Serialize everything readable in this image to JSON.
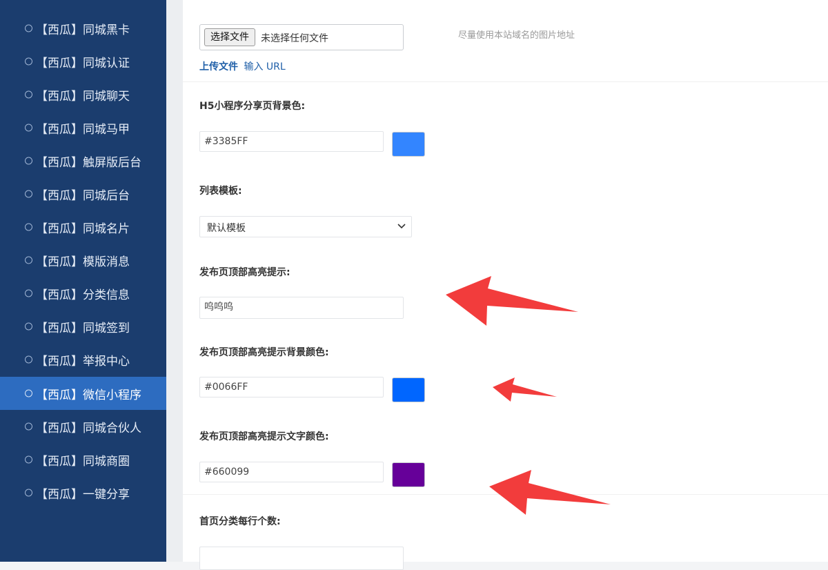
{
  "sidebar": {
    "items": [
      {
        "label": "【西瓜】同城黑卡",
        "active": false
      },
      {
        "label": "【西瓜】同城认证",
        "active": false
      },
      {
        "label": "【西瓜】同城聊天",
        "active": false
      },
      {
        "label": "【西瓜】同城马甲",
        "active": false
      },
      {
        "label": "【西瓜】触屏版后台",
        "active": false
      },
      {
        "label": "【西瓜】同城后台",
        "active": false
      },
      {
        "label": "【西瓜】同城名片",
        "active": false
      },
      {
        "label": "【西瓜】模版消息",
        "active": false
      },
      {
        "label": "【西瓜】分类信息",
        "active": false
      },
      {
        "label": "【西瓜】同城签到",
        "active": false
      },
      {
        "label": "【西瓜】举报中心",
        "active": false
      },
      {
        "label": "【西瓜】微信小程序",
        "active": true
      },
      {
        "label": "【西瓜】同城合伙人",
        "active": false
      },
      {
        "label": "【西瓜】同城商圈",
        "active": false
      },
      {
        "label": "【西瓜】一键分享",
        "active": false
      }
    ]
  },
  "form": {
    "share_bg_image": {
      "file_button": "选择文件",
      "file_status": "未选择任何文件",
      "hint": "尽量使用本站域名的图片地址",
      "upload_link": "上传文件",
      "url_link": "输入 URL"
    },
    "share_bg_color": {
      "label": "H5小程序分享页背景色:",
      "value": "#3385FF",
      "swatch": "#3385FF"
    },
    "list_template": {
      "label": "列表模板:",
      "selected": "默认模板"
    },
    "highlight_tip": {
      "label": "发布页顶部高亮提示:",
      "value": "呜呜呜"
    },
    "highlight_bg_color": {
      "label": "发布页顶部高亮提示背景颜色:",
      "value": "#0066FF",
      "swatch": "#0066FF"
    },
    "highlight_text_color": {
      "label": "发布页顶部高亮提示文字颜色:",
      "value": "#660099",
      "swatch": "#660099"
    },
    "per_row": {
      "label": "首页分类每行个数:",
      "value": ""
    }
  },
  "colors": {
    "sidebar_bg": "#1b3d6e",
    "sidebar_active": "#2d6cc0",
    "link": "#1f5fa8",
    "annotation_arrow": "#f23c3c"
  }
}
